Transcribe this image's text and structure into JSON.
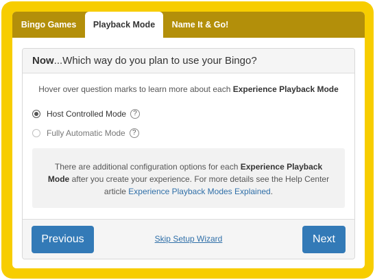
{
  "tabs": [
    {
      "label": "Bingo Games",
      "active": false
    },
    {
      "label": "Playback Mode",
      "active": true
    },
    {
      "label": "Name It & Go!",
      "active": false
    }
  ],
  "card": {
    "title_bold": "Now",
    "title_rest": "...Which way do you plan to use your Bingo?"
  },
  "hint": {
    "text": "Hover over question marks to learn more about each ",
    "bold": "Experience Playback Mode"
  },
  "options": [
    {
      "label": "Host Controlled Mode",
      "selected": true,
      "help": "?"
    },
    {
      "label": "Fully Automatic Mode",
      "selected": false,
      "help": "?"
    }
  ],
  "info": {
    "text1": "There are additional configuration options for each ",
    "bold": "Experience Playback Mode",
    "text2": " after you create your experience. For more details see the Help Center article ",
    "link": "Experience Playback Modes Explained",
    "text3": "."
  },
  "footer": {
    "previous": "Previous",
    "skip": "Skip Setup Wizard",
    "next": "Next"
  },
  "colors": {
    "frame": "#f7cd00",
    "tabbar": "#b38f0a",
    "button": "#337ab7",
    "link": "#2f6fa8"
  }
}
